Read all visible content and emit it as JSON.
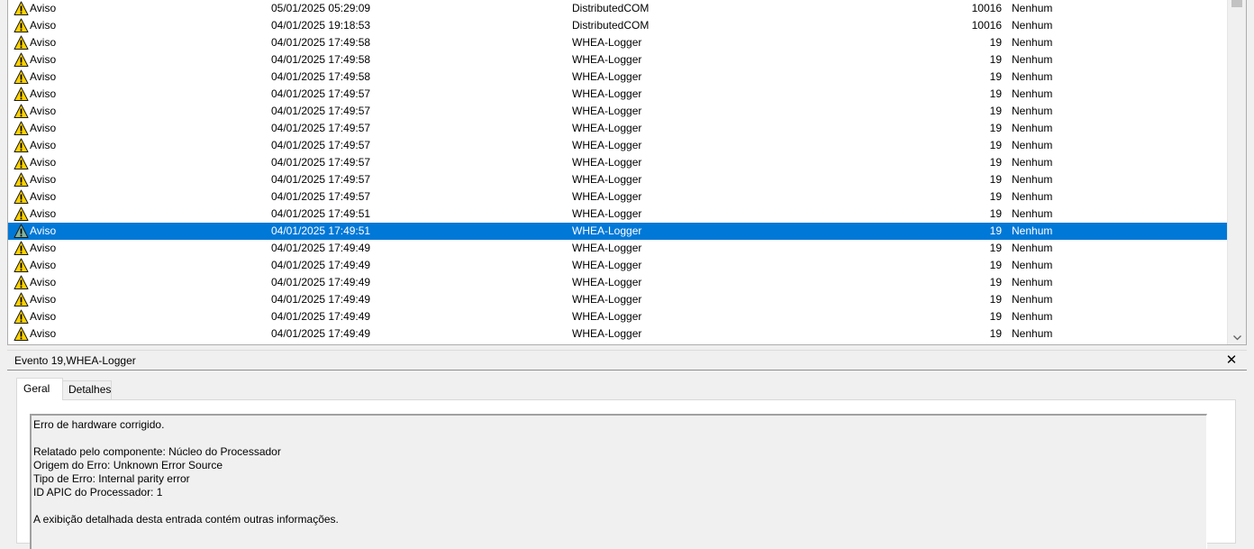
{
  "events": [
    {
      "level": "Aviso",
      "date": "05/01/2025 05:29:09",
      "source": "DistributedCOM",
      "id": "10016",
      "task": "Nenhum"
    },
    {
      "level": "Aviso",
      "date": "04/01/2025 19:18:53",
      "source": "DistributedCOM",
      "id": "10016",
      "task": "Nenhum"
    },
    {
      "level": "Aviso",
      "date": "04/01/2025 17:49:58",
      "source": "WHEA-Logger",
      "id": "19",
      "task": "Nenhum"
    },
    {
      "level": "Aviso",
      "date": "04/01/2025 17:49:58",
      "source": "WHEA-Logger",
      "id": "19",
      "task": "Nenhum"
    },
    {
      "level": "Aviso",
      "date": "04/01/2025 17:49:58",
      "source": "WHEA-Logger",
      "id": "19",
      "task": "Nenhum"
    },
    {
      "level": "Aviso",
      "date": "04/01/2025 17:49:57",
      "source": "WHEA-Logger",
      "id": "19",
      "task": "Nenhum"
    },
    {
      "level": "Aviso",
      "date": "04/01/2025 17:49:57",
      "source": "WHEA-Logger",
      "id": "19",
      "task": "Nenhum"
    },
    {
      "level": "Aviso",
      "date": "04/01/2025 17:49:57",
      "source": "WHEA-Logger",
      "id": "19",
      "task": "Nenhum"
    },
    {
      "level": "Aviso",
      "date": "04/01/2025 17:49:57",
      "source": "WHEA-Logger",
      "id": "19",
      "task": "Nenhum"
    },
    {
      "level": "Aviso",
      "date": "04/01/2025 17:49:57",
      "source": "WHEA-Logger",
      "id": "19",
      "task": "Nenhum"
    },
    {
      "level": "Aviso",
      "date": "04/01/2025 17:49:57",
      "source": "WHEA-Logger",
      "id": "19",
      "task": "Nenhum"
    },
    {
      "level": "Aviso",
      "date": "04/01/2025 17:49:57",
      "source": "WHEA-Logger",
      "id": "19",
      "task": "Nenhum"
    },
    {
      "level": "Aviso",
      "date": "04/01/2025 17:49:51",
      "source": "WHEA-Logger",
      "id": "19",
      "task": "Nenhum"
    },
    {
      "level": "Aviso",
      "date": "04/01/2025 17:49:51",
      "source": "WHEA-Logger",
      "id": "19",
      "task": "Nenhum",
      "selected": true
    },
    {
      "level": "Aviso",
      "date": "04/01/2025 17:49:49",
      "source": "WHEA-Logger",
      "id": "19",
      "task": "Nenhum"
    },
    {
      "level": "Aviso",
      "date": "04/01/2025 17:49:49",
      "source": "WHEA-Logger",
      "id": "19",
      "task": "Nenhum"
    },
    {
      "level": "Aviso",
      "date": "04/01/2025 17:49:49",
      "source": "WHEA-Logger",
      "id": "19",
      "task": "Nenhum"
    },
    {
      "level": "Aviso",
      "date": "04/01/2025 17:49:49",
      "source": "WHEA-Logger",
      "id": "19",
      "task": "Nenhum"
    },
    {
      "level": "Aviso",
      "date": "04/01/2025 17:49:49",
      "source": "WHEA-Logger",
      "id": "19",
      "task": "Nenhum"
    },
    {
      "level": "Aviso",
      "date": "04/01/2025 17:49:49",
      "source": "WHEA-Logger",
      "id": "19",
      "task": "Nenhum"
    }
  ],
  "icons": {
    "warning": "warning-icon",
    "close": "close-icon",
    "scroll_down": "chevron-down-icon"
  },
  "colors": {
    "selection": "#0078d7",
    "warning_fill": "#ffd200",
    "warning_selected_fill": "#7fb3a0"
  },
  "detail": {
    "title": "Evento 19,WHEA-Logger",
    "close_glyph": "✕",
    "tabs": [
      {
        "label": "Geral",
        "active": true
      },
      {
        "label": "Detalhes",
        "active": false
      }
    ],
    "lines": [
      "Erro de hardware corrigido.",
      "",
      "Relatado pelo componente: Núcleo do Processador",
      "Origem do Erro: Unknown Error Source",
      "Tipo de Erro: Internal parity error",
      "ID APIC do Processador: 1",
      "",
      "A exibição detalhada desta entrada contém outras informações."
    ]
  }
}
